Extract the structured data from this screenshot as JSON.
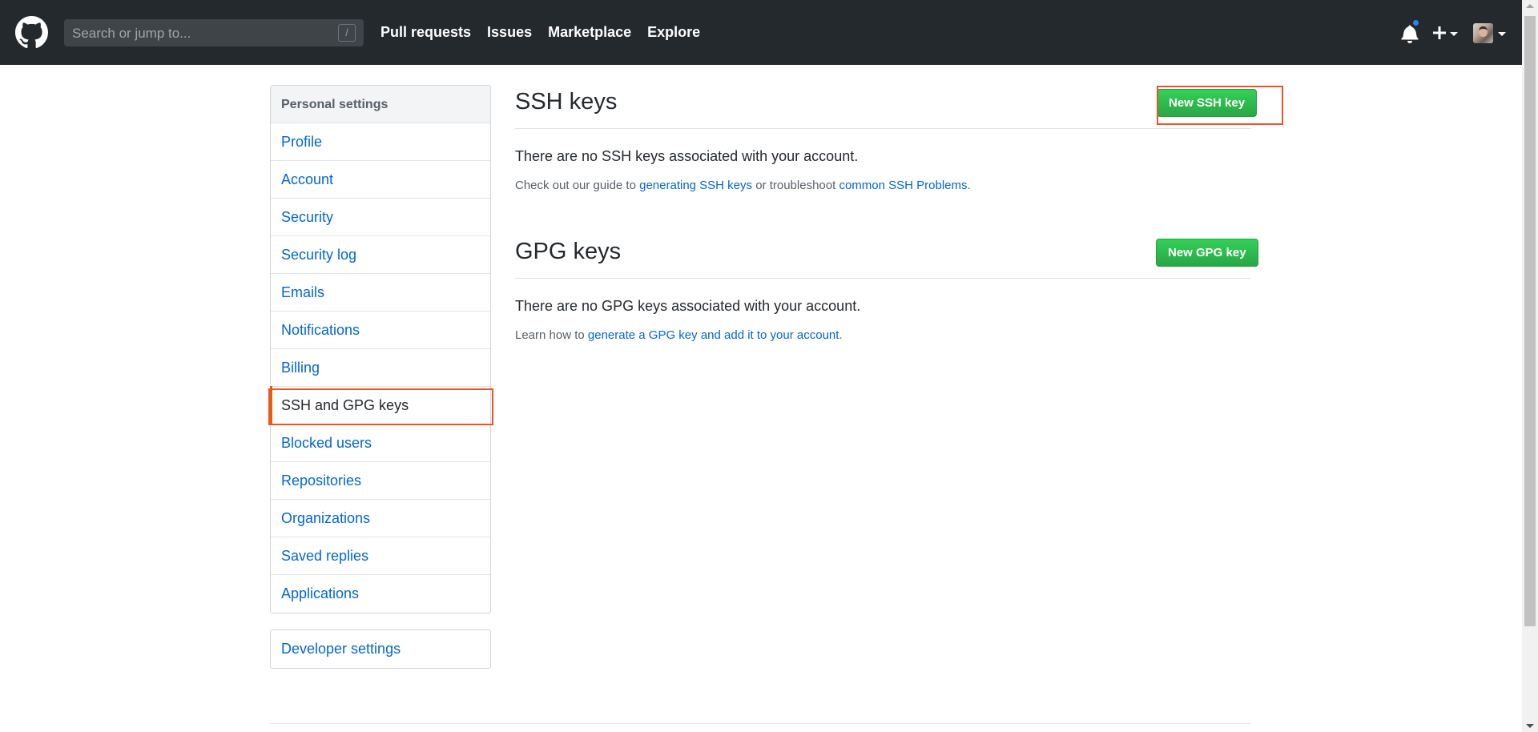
{
  "header": {
    "search_placeholder": "Search or jump to...",
    "search_shortcut": "/",
    "nav": [
      "Pull requests",
      "Issues",
      "Marketplace",
      "Explore"
    ]
  },
  "sidebar": {
    "heading": "Personal settings",
    "items": [
      {
        "label": "Profile"
      },
      {
        "label": "Account"
      },
      {
        "label": "Security"
      },
      {
        "label": "Security log"
      },
      {
        "label": "Emails"
      },
      {
        "label": "Notifications"
      },
      {
        "label": "Billing"
      },
      {
        "label": "SSH and GPG keys",
        "selected": true
      },
      {
        "label": "Blocked users"
      },
      {
        "label": "Repositories"
      },
      {
        "label": "Organizations"
      },
      {
        "label": "Saved replies"
      },
      {
        "label": "Applications"
      }
    ],
    "developer_settings": "Developer settings"
  },
  "ssh": {
    "title": "SSH keys",
    "new_button": "New SSH key",
    "blank_text": "There are no SSH keys associated with your account.",
    "note_prefix": "Check out our guide to ",
    "note_link1": "generating SSH keys",
    "note_middle": " or troubleshoot ",
    "note_link2": "common SSH Problems",
    "note_suffix": "."
  },
  "gpg": {
    "title": "GPG keys",
    "new_button": "New GPG key",
    "blank_text": "There are no GPG keys associated with your account.",
    "note_prefix": "Learn how to ",
    "note_link": "generate a GPG key and add it to your account",
    "note_suffix": "."
  },
  "colors": {
    "header_bg": "#24292e",
    "link": "#0366d6",
    "primary_button": "#28a745",
    "highlight": "#f05323",
    "notification_dot": "#2188ff"
  }
}
